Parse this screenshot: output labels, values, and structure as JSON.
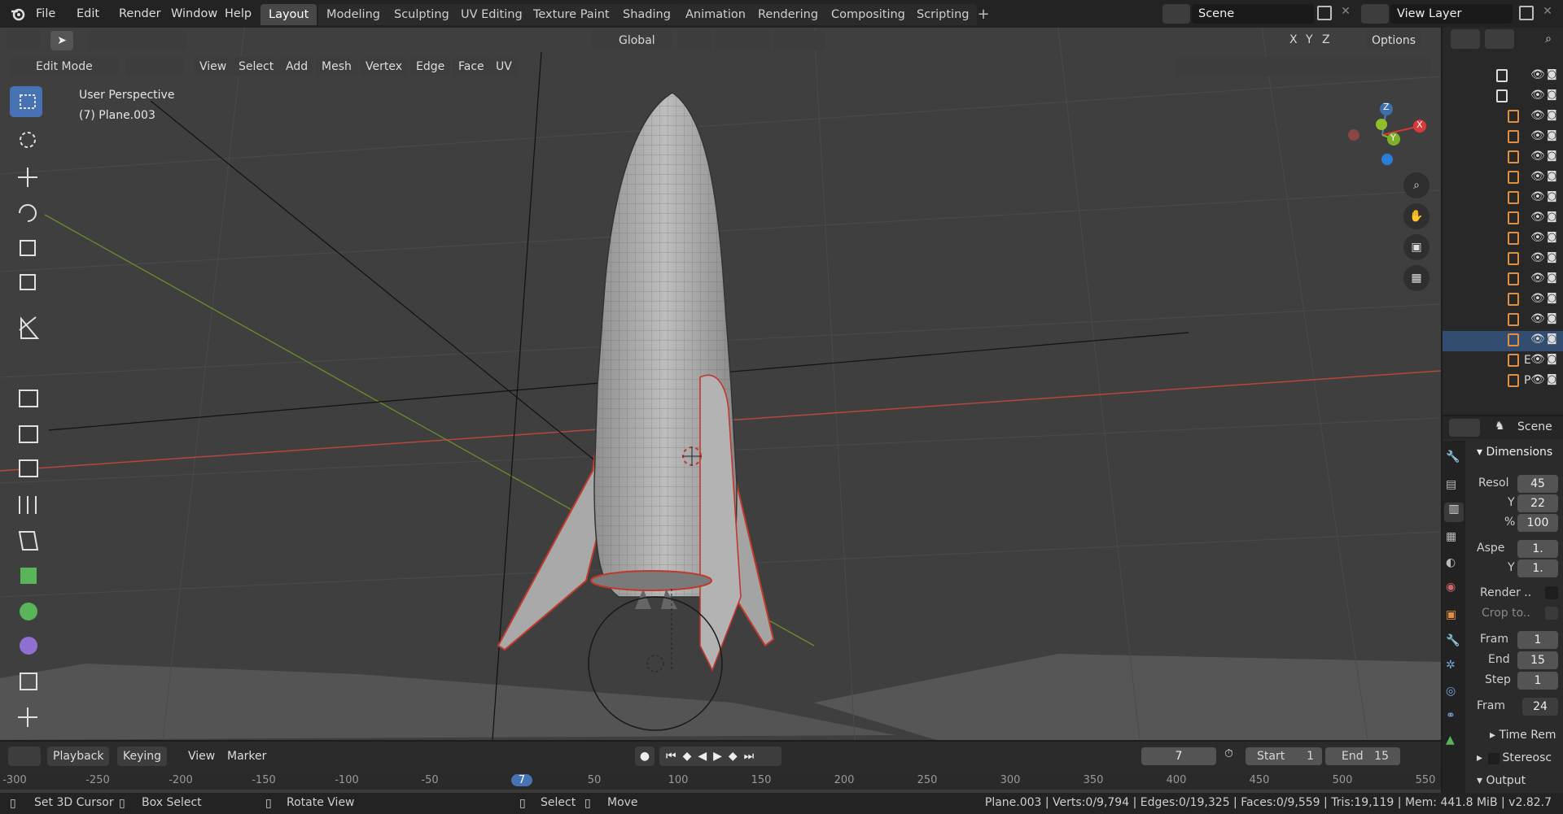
{
  "menu": [
    "File",
    "Edit",
    "Render",
    "Window",
    "Help"
  ],
  "workspaces": [
    "Layout",
    "Modeling",
    "Sculpting",
    "UV Editing",
    "Texture Paint",
    "Shading",
    "Animation",
    "Rendering",
    "Compositing",
    "Scripting"
  ],
  "active_workspace": "Layout",
  "scene_name": "Scene",
  "view_layer": "View Layer",
  "header": {
    "transform_orientation": "Global",
    "axes": [
      "X",
      "Y",
      "Z"
    ],
    "options": "Options",
    "mode": "Edit Mode",
    "menus": [
      "View",
      "Select",
      "Add",
      "Mesh",
      "Vertex",
      "Edge",
      "Face",
      "UV"
    ]
  },
  "viewport": {
    "perspective": "User Perspective",
    "object": "(7) Plane.003",
    "gizmo": {
      "z": "Z",
      "y": "Y",
      "x": "X"
    }
  },
  "outliner": {
    "rows": [
      "",
      "",
      "",
      "",
      "",
      "",
      "",
      "",
      "",
      "",
      "",
      "",
      "",
      "",
      "E",
      "P"
    ]
  },
  "properties": {
    "tab_title": "Scene",
    "section": "Dimensions",
    "resolution_x_label": "Resol",
    "resolution_x": "45",
    "resolution_y_label": "Y",
    "resolution_y": "22",
    "percent_label": "%",
    "percent": "100",
    "aspect_x_label": "Aspe",
    "aspect_x": "1.",
    "aspect_y_label": "Y",
    "aspect_y": "1.",
    "render_label": "Render ..",
    "crop_label": "Crop to..",
    "frame_start_label": "Fram",
    "frame_start": "1",
    "frame_end_label": "End",
    "frame_end": "15",
    "frame_step_label": "Step",
    "frame_step": "1",
    "frame_rate_label": "Fram",
    "frame_rate": "24",
    "time_remap": "Time Rem",
    "stereoscopy": "Stereosc",
    "output": "Output"
  },
  "timeline": {
    "menus": [
      "Playback",
      "Keying",
      "View",
      "Marker"
    ],
    "current_frame": "7",
    "start_label": "Start",
    "start": "1",
    "end_label": "End",
    "end": "15",
    "ruler": [
      "-300",
      "-250",
      "-200",
      "-150",
      "-100",
      "-50",
      "7",
      "50",
      "100",
      "150",
      "200",
      "250",
      "300",
      "350",
      "400",
      "450",
      "500",
      "550"
    ]
  },
  "status": {
    "set_cursor": "Set 3D Cursor",
    "box_select": "Box Select",
    "rotate_view": "Rotate View",
    "select": "Select",
    "move": "Move",
    "stats": "Plane.003 | Verts:0/9,794 | Edges:0/19,325 | Faces:0/9,559 | Tris:19,119 | Mem: 441.8 MiB | v2.82.7"
  },
  "colors": {
    "accent": "#4772b3",
    "x_axis": "#c0392b",
    "y_axis": "#6a8f2a",
    "viewport_bg": "#3f3f3f"
  }
}
